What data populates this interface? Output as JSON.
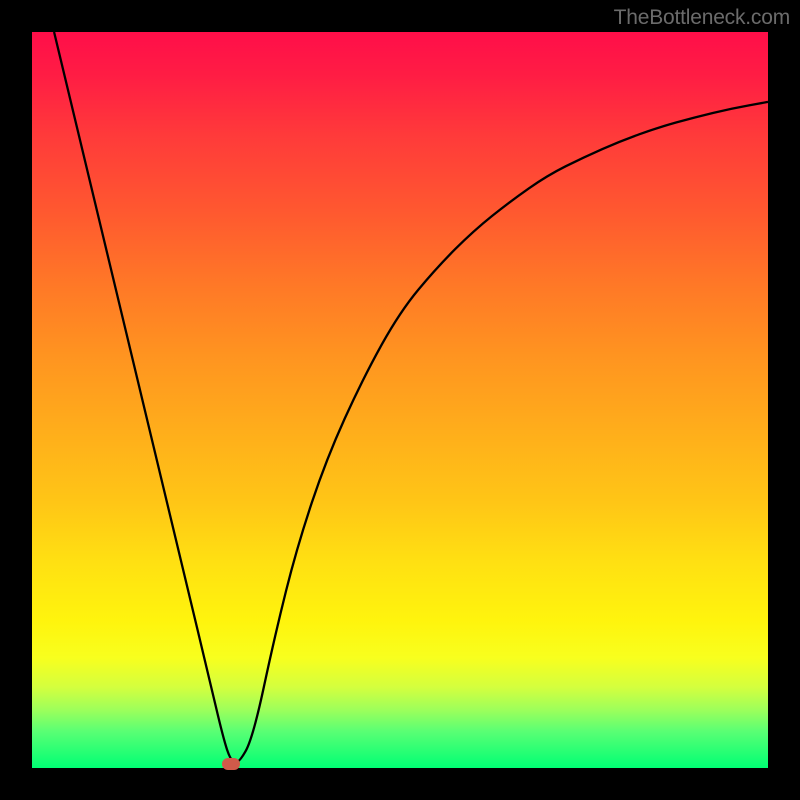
{
  "watermark": "TheBottleneck.com",
  "chart_data": {
    "type": "line",
    "title": "",
    "xlabel": "",
    "ylabel": "",
    "xlim": [
      0,
      100
    ],
    "ylim": [
      0,
      100
    ],
    "grid": false,
    "gradient_background": {
      "top_color": "#ff0e49",
      "bottom_color": "#00ff74",
      "description": "red-to-green vertical gradient"
    },
    "series": [
      {
        "name": "curve",
        "x": [
          3,
          6,
          9,
          12,
          15,
          18,
          21,
          24,
          26,
          27,
          28,
          30,
          33,
          36,
          40,
          45,
          50,
          55,
          60,
          65,
          70,
          75,
          80,
          85,
          90,
          95,
          100
        ],
        "y": [
          100,
          87.5,
          75,
          62.5,
          50,
          37.5,
          25,
          12.5,
          4,
          1,
          0.5,
          4,
          18,
          30,
          42,
          53,
          62,
          68,
          73,
          77,
          80.5,
          83,
          85.2,
          87,
          88.4,
          89.6,
          90.5
        ]
      }
    ],
    "marker": {
      "x": 27,
      "y": 0.5,
      "color": "#d05a4a"
    }
  }
}
